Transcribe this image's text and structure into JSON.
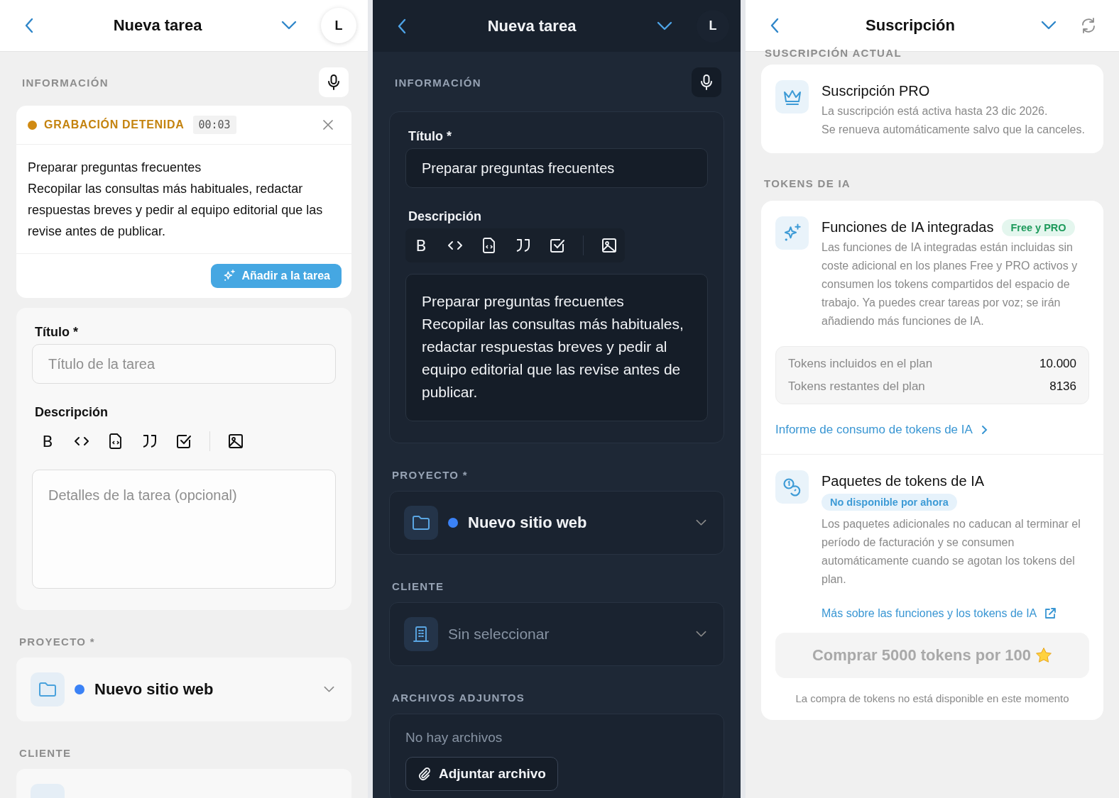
{
  "light_task": {
    "header": {
      "title": "Nueva tarea",
      "avatar": "L"
    },
    "info_label": "INFORMACIÓN",
    "recording": {
      "status": "GRABACIÓN DETENIDA",
      "time": "00:03",
      "transcript": [
        "Preparar preguntas frecuentes",
        "Recopilar las consultas más habituales, redactar respuestas breves y pedir al equipo editorial que las revise antes de publicar."
      ],
      "add_button": "Añadir a la tarea"
    },
    "form": {
      "title_label": "Título *",
      "title_placeholder": "Título de la tarea",
      "description_label": "Descripción",
      "bold_label": "B",
      "description_placeholder": "Detalles de la tarea (opcional)"
    },
    "project": {
      "label": "PROYECTO *",
      "name": "Nuevo sitio web",
      "color": "#3b82f6"
    },
    "client": {
      "label": "CLIENTE"
    }
  },
  "dark_task": {
    "header": {
      "title": "Nueva tarea",
      "avatar": "L"
    },
    "info_label": "INFORMACIÓN",
    "form": {
      "title_label": "Título *",
      "title_value": "Preparar preguntas frecuentes",
      "description_label": "Descripción",
      "bold_label": "B",
      "description_value": [
        "Preparar preguntas frecuentes",
        "Recopilar las consultas más habituales, redactar respuestas breves y pedir al equipo editorial que las revise antes de publicar."
      ]
    },
    "project": {
      "label": "PROYECTO *",
      "name": "Nuevo sitio web",
      "color": "#3b82f6"
    },
    "client": {
      "label": "CLIENTE",
      "placeholder": "Sin seleccionar"
    },
    "attachments": {
      "label": "ARCHIVOS ADJUNTOS",
      "empty": "No hay archivos",
      "button": "Adjuntar archivo"
    }
  },
  "subscription": {
    "header": {
      "title": "Suscripción"
    },
    "current_label": "SUSCRIPCIÓN ACTUAL",
    "plan": {
      "title": "Suscripción PRO",
      "lines": [
        "La suscripción está activa hasta 23 dic 2026.",
        "Se renueva automáticamente salvo que la canceles."
      ]
    },
    "tokens_label": "TOKENS DE IA",
    "features": {
      "title": "Funciones de IA integradas",
      "badge": "Free y PRO",
      "description": "Las funciones de IA integradas están incluidas sin coste adicional en los planes Free y PRO activos y consumen los tokens compartidos del espacio de trabajo. Ya puedes crear tareas por voz; se irán añadiendo más funciones de IA.",
      "stats": [
        {
          "label": "Tokens incluidos en el plan",
          "value": "10.000"
        },
        {
          "label": "Tokens restantes del plan",
          "value": "8136"
        }
      ],
      "link": "Informe de consumo de tokens de IA"
    },
    "packs": {
      "title": "Paquetes de tokens de IA",
      "badge": "No disponible por ahora",
      "description": "Los paquetes adicionales no caducan al terminar el período de facturación y se consumen automáticamente cuando se agotan los tokens del plan.",
      "link": "Más sobre las funciones y los tokens de IA",
      "buy_button": {
        "label": "Comprar 5000 tokens por 100",
        "disabled": true
      },
      "note": "La compra de tokens no está disponible en este momento"
    }
  }
}
